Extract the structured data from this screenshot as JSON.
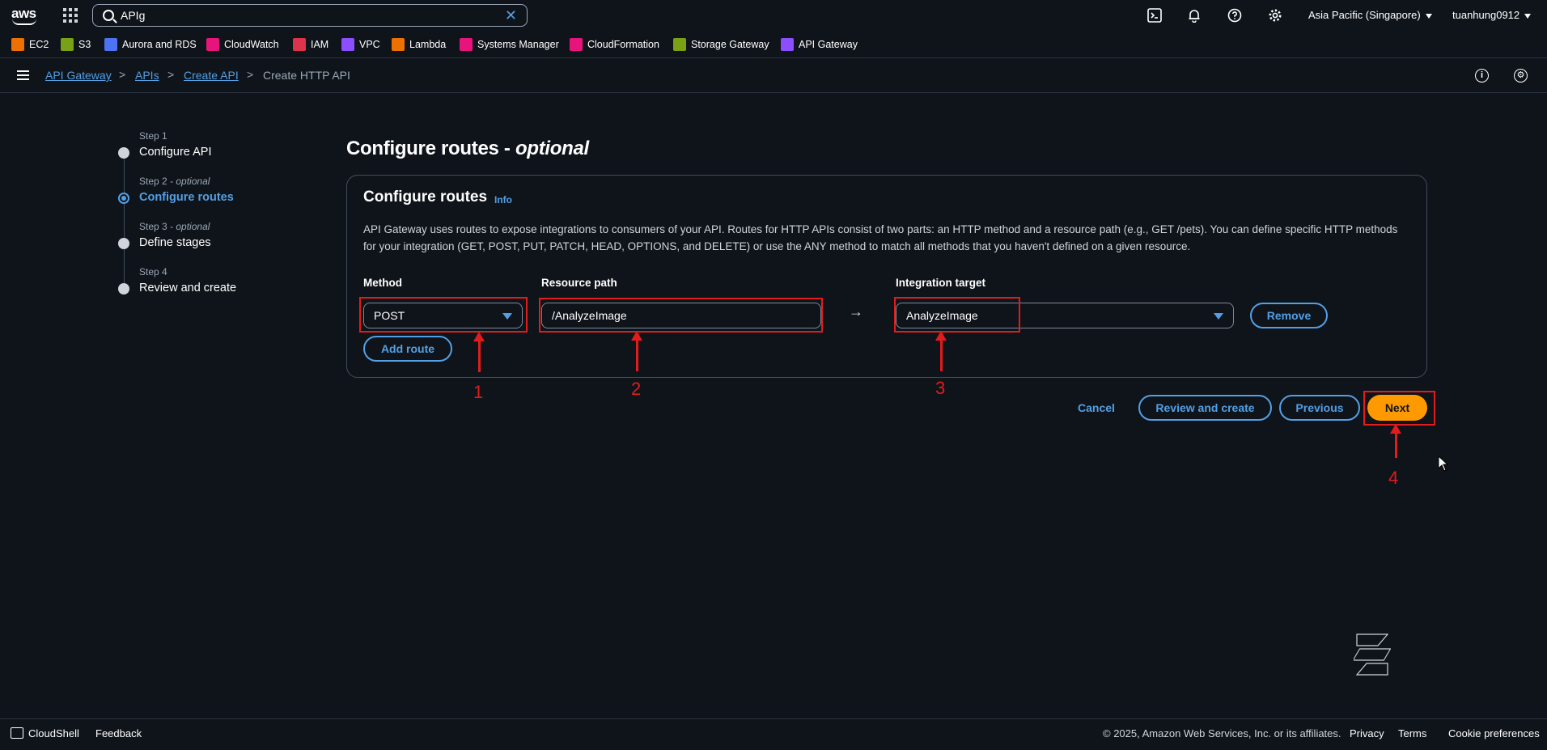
{
  "topnav": {
    "logo_text": "aws",
    "search_value": "APIg",
    "region": "Asia Pacific (Singapore)",
    "user": "tuanhung0912"
  },
  "favorites": [
    {
      "label": "EC2",
      "color": "#ed7100"
    },
    {
      "label": "S3",
      "color": "#7aa116"
    },
    {
      "label": "Aurora and RDS",
      "color": "#4d72f3"
    },
    {
      "label": "CloudWatch",
      "color": "#e7157b"
    },
    {
      "label": "IAM",
      "color": "#dd344c"
    },
    {
      "label": "VPC",
      "color": "#8c4fff"
    },
    {
      "label": "Lambda",
      "color": "#ed7100"
    },
    {
      "label": "Systems Manager",
      "color": "#e7157b"
    },
    {
      "label": "CloudFormation",
      "color": "#e7157b"
    },
    {
      "label": "Storage Gateway",
      "color": "#7aa116"
    },
    {
      "label": "API Gateway",
      "color": "#8c4fff"
    }
  ],
  "breadcrumb": {
    "items": [
      "API Gateway",
      "APIs",
      "Create API"
    ],
    "current": "Create HTTP API"
  },
  "steps": [
    {
      "label": "Step 1",
      "optional": "",
      "title": "Configure API"
    },
    {
      "label": "Step 2",
      "optional": " - optional",
      "title": "Configure routes"
    },
    {
      "label": "Step 3",
      "optional": " - optional",
      "title": "Define stages"
    },
    {
      "label": "Step 4",
      "optional": "",
      "title": "Review and create"
    }
  ],
  "main": {
    "title": "Configure routes - ",
    "title_em": "optional",
    "container_title": "Configure routes",
    "info": "Info",
    "description": "API Gateway uses routes to expose integrations to consumers of your API. Routes for HTTP APIs consist of two parts: an HTTP method and a resource path (e.g., GET /pets). You can define specific HTTP methods for your integration (GET, POST, PUT, PATCH, HEAD, OPTIONS, and DELETE) or use the ANY method to match all methods that you haven't defined on a given resource.",
    "method_label": "Method",
    "method_value": "POST",
    "resource_label": "Resource path",
    "resource_value": "/AnalyzeImage",
    "integration_label": "Integration target",
    "integration_value": "AnalyzeImage",
    "arrow": "→",
    "remove": "Remove",
    "add_route": "Add route"
  },
  "actions": {
    "cancel": "Cancel",
    "review": "Review and create",
    "previous": "Previous",
    "next": "Next"
  },
  "annotations": [
    "1",
    "2",
    "3",
    "4"
  ],
  "footer": {
    "cloudshell": "CloudShell",
    "feedback": "Feedback",
    "copyright": "© 2025, Amazon Web Services, Inc. or its affiliates.",
    "privacy": "Privacy",
    "terms": "Terms",
    "cookies": "Cookie preferences"
  }
}
